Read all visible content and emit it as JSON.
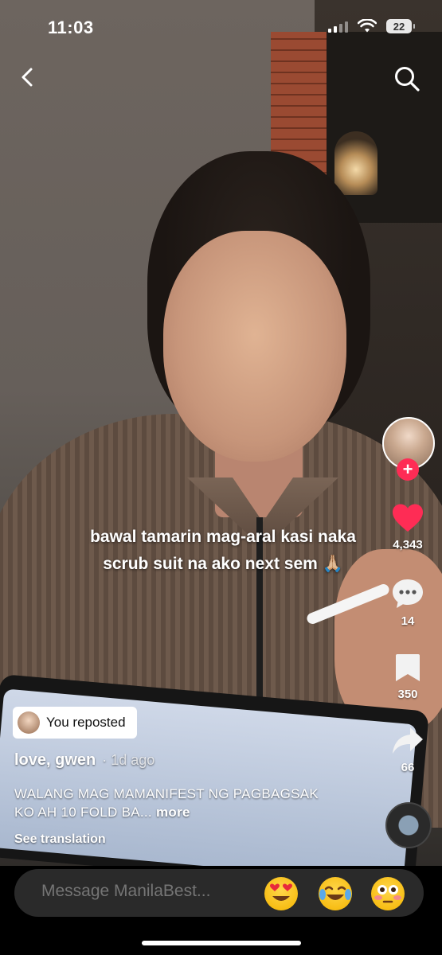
{
  "status_bar": {
    "time": "11:03",
    "battery": "22",
    "icons": [
      "signal-icon",
      "wifi-icon",
      "battery-icon"
    ]
  },
  "top_bar": {
    "icons": [
      "back-chevron-icon",
      "search-icon"
    ]
  },
  "video": {
    "overlay_caption": "bawal tamarin mag-aral kasi naka scrub suit na ako next sem 🙏🏼"
  },
  "rail": {
    "likes": "4,343",
    "comments": "14",
    "saves": "350",
    "shares": "66",
    "follow_symbol": "+",
    "colors": {
      "like": "#fe2c55",
      "follow": "#fe2c55"
    }
  },
  "post": {
    "repost_label": "You reposted",
    "author": "love, gwen",
    "time_ago": "· 1d ago",
    "description": "WALANG MAG MAMANIFEST NG PAGBAGSAK KO AH 10 FOLD BA...",
    "more_label": "more",
    "see_translation": "See translation"
  },
  "message_bar": {
    "placeholder": "Message ManilaBest...",
    "emoji_reactions": [
      "😍",
      "😂",
      "😳"
    ]
  }
}
